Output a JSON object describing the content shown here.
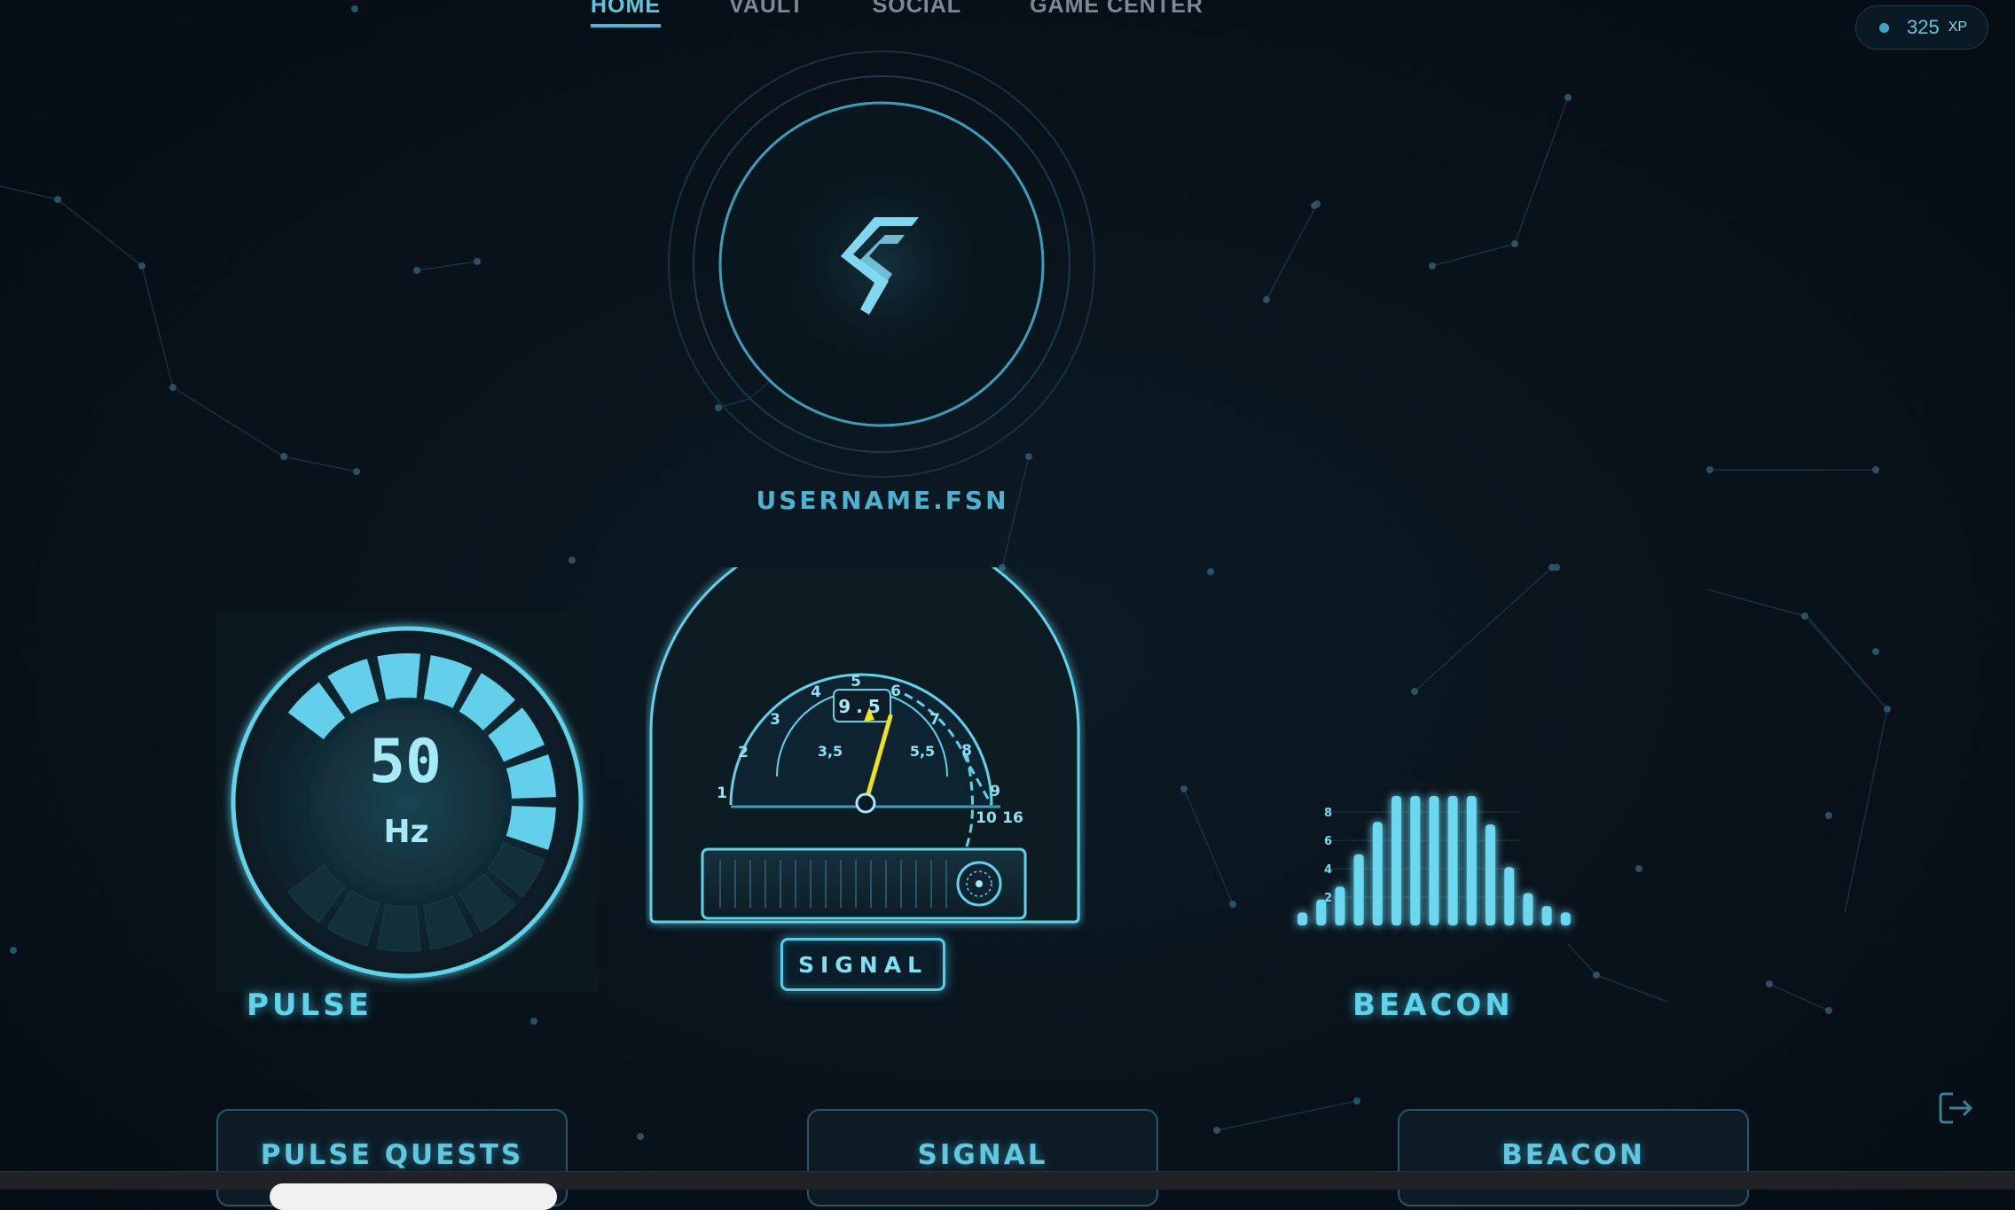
{
  "nav": {
    "tabs": [
      {
        "label": "HOME",
        "active": true
      },
      {
        "label": "VAULT",
        "active": false
      },
      {
        "label": "SOCIAL",
        "active": false
      },
      {
        "label": "GAME CENTER",
        "active": false
      }
    ]
  },
  "xp": {
    "value": "325",
    "unit": "XP"
  },
  "profile": {
    "username": "USERNAME.FSN",
    "logo_icon": "zigzag-s-logo-icon"
  },
  "pulse": {
    "value": "50",
    "unit": "Hz",
    "label": "PULSE",
    "level_fraction": 0.47
  },
  "signal": {
    "label": "SIGNAL",
    "outer_ticks": [
      "1",
      "2",
      "3",
      "4",
      "5",
      "6",
      "7",
      "8",
      "9",
      "10",
      "16"
    ],
    "inner_ticks": [
      "3,5",
      "5,5"
    ],
    "readout": "9.5",
    "needle_color": "#f3e21a"
  },
  "beacon": {
    "label": "BEACON",
    "axis_ticks": [
      "8",
      "6",
      "4",
      "2"
    ],
    "bars": [
      0.1,
      0.2,
      0.3,
      0.55,
      0.8,
      1.0,
      1.0,
      1.0,
      1.0,
      1.0,
      0.78,
      0.45,
      0.25,
      0.15,
      0.1
    ]
  },
  "cards": [
    {
      "label": "PULSE QUESTS"
    },
    {
      "label": "SIGNAL"
    },
    {
      "label": "BEACON"
    }
  ],
  "colors": {
    "accent": "#5fd3ea",
    "background": "#08121a",
    "needle": "#f3e21a"
  },
  "icons": {
    "logout": "logout-icon"
  }
}
